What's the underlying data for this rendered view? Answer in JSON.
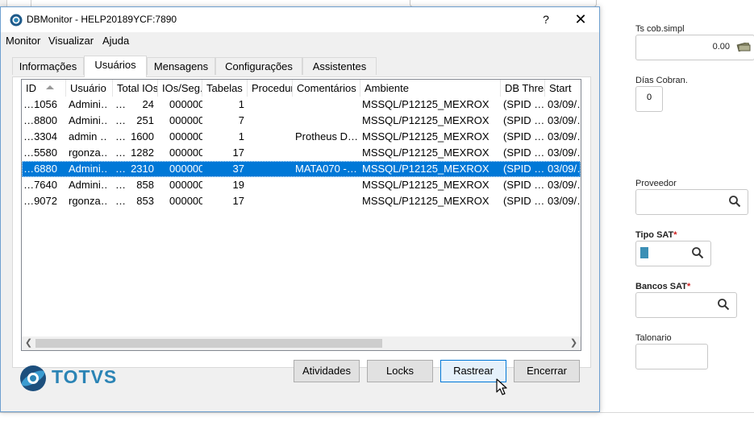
{
  "window": {
    "title": "DBMonitor - HELP20189YCF:7890",
    "help_label": "?",
    "close_label": "✕"
  },
  "menu": [
    "Monitor",
    "Visualizar",
    "Ajuda"
  ],
  "tabs": [
    "Informações",
    "Usuários",
    "Mensagens",
    "Configurações",
    "Assistentes"
  ],
  "active_tab": "Usuários",
  "table": {
    "columns": [
      "ID",
      "Usuário",
      "Total IOs",
      "IOs/Seg.",
      "Tabelas",
      "Procedures",
      "Comentários",
      "Ambiente",
      "DB Thread",
      "Start"
    ],
    "rows": [
      [
        "…1056",
        "Admini…",
        "…",
        "24",
        "000000",
        "1",
        "",
        "",
        "MSSQL/P12125_MEXROX",
        "(SPID …",
        "03/09/…"
      ],
      [
        "…8800",
        "Admini…",
        "…",
        "251",
        "000000",
        "7",
        "",
        "",
        "MSSQL/P12125_MEXROX",
        "(SPID …",
        "03/09/…"
      ],
      [
        "…3304",
        "admin …",
        "…",
        "1600",
        "000000",
        "1",
        "",
        "Protheus D…",
        "MSSQL/P12125_MEXROX",
        "(SPID …",
        "03/09/…"
      ],
      [
        "…5580",
        "rgonza…",
        "…",
        "1282",
        "000000",
        "17",
        "",
        "",
        "MSSQL/P12125_MEXROX",
        "(SPID …",
        "03/09/…"
      ],
      [
        "…6880",
        "Admini…",
        "…",
        "2310",
        "000000",
        "37",
        "",
        "MATA070 -…",
        "MSSQL/P12125_MEXROX",
        "(SPID …",
        "03/09/…"
      ],
      [
        "…7640",
        "Admini…",
        "…",
        "858",
        "000000",
        "19",
        "",
        "",
        "MSSQL/P12125_MEXROX",
        "(SPID …",
        "03/09/…"
      ],
      [
        "…9072",
        "rgonza…",
        "…",
        "853",
        "000000",
        "17",
        "",
        "",
        "MSSQL/P12125_MEXROX",
        "(SPID …",
        "03/09/…"
      ]
    ],
    "selected_row": 4
  },
  "logo_text": "TOTVS",
  "buttons": [
    "Atividades",
    "Locks",
    "Rastrear",
    "Encerrar"
  ],
  "right_form": {
    "ts_cob_label": "Ts cob.simpl",
    "ts_cob_value": "0.00",
    "dias_label": "Días Cobran.",
    "dias_value": "0",
    "proveedor_label": "Proveedor",
    "tipo_sat_label": "Tipo SAT",
    "bancos_sat_label": "Bancos SAT",
    "talonario_label": "Talonario",
    "required_mark": "*"
  },
  "colors": {
    "selection": "#0078d7",
    "logo": "#2b84b5",
    "required": "#d02020"
  }
}
